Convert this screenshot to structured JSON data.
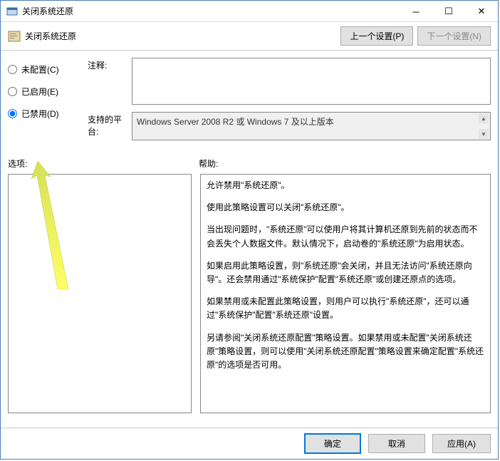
{
  "window": {
    "title": "关闭系统还原"
  },
  "toolbar": {
    "title": "关闭系统还原",
    "prev_button": "上一个设置(P)",
    "next_button": "下一个设置(N)"
  },
  "radios": {
    "not_configured": "未配置(C)",
    "enabled": "已启用(E)",
    "disabled": "已禁用(D)",
    "selected": "disabled"
  },
  "fields": {
    "comment_label": "注释:",
    "comment_value": "",
    "platform_label": "支持的平台:",
    "platform_value": "Windows Server 2008 R2 或 Windows 7 及以上版本"
  },
  "sections": {
    "options_label": "选项:",
    "help_label": "帮助:"
  },
  "help": {
    "p1": "允许禁用\"系统还原\"。",
    "p2": "使用此策略设置可以关闭\"系统还原\"。",
    "p3": "当出现问题时，\"系统还原\"可以使用户将其计算机还原到先前的状态而不会丢失个人数据文件。默认情况下，启动卷的\"系统还原\"为启用状态。",
    "p4": "如果启用此策略设置，则\"系统还原\"会关闭，并且无法访问\"系统还原向导\"。还会禁用通过\"系统保护\"配置\"系统还原\"或创建还原点的选项。",
    "p5": "如果禁用或未配置此策略设置，则用户可以执行\"系统还原\"，还可以通过\"系统保护\"配置\"系统还原\"设置。",
    "p6": "另请参阅\"关闭系统还原配置\"策略设置。如果禁用或未配置\"关闭系统还原\"策略设置，则可以使用\"关闭系统还原配置\"策略设置来确定配置\"系统还原\"的选项是否可用。"
  },
  "footer": {
    "ok": "确定",
    "cancel": "取消",
    "apply": "应用(A)"
  }
}
